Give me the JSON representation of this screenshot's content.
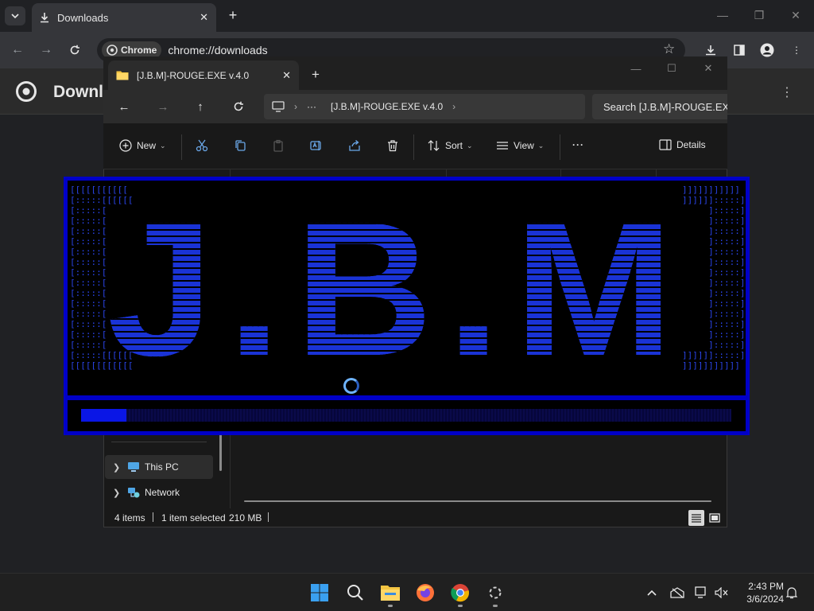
{
  "chrome": {
    "tab_title": "Downloads",
    "chip_label": "Chrome",
    "url": "chrome://downloads",
    "page_title": "Downloads"
  },
  "explorer": {
    "tab_title": "[J.B.M]-ROUGE.EXE v.4.0",
    "breadcrumb_more": "···",
    "breadcrumb_folder": "[J.B.M]-ROUGE.EXE v.4.0",
    "search_placeholder": "Search [J.B.M]-ROUGE.EX",
    "commands": {
      "new": "New",
      "sort": "Sort",
      "view": "View",
      "more": "···",
      "details": "Details"
    },
    "nav": [
      {
        "label": "This PC",
        "icon": "pc-icon"
      },
      {
        "label": "Network",
        "icon": "network-icon"
      }
    ],
    "status": {
      "items": "4 items",
      "selected": "1 item selected",
      "size": "210 MB"
    }
  },
  "splash": {
    "logo_text": "J.B.M",
    "progress": 0.07,
    "accent_color": "#0000c8"
  },
  "taskbar": {
    "time": "2:43 PM",
    "date": "3/6/2024",
    "apps": [
      "windows-start-icon",
      "search-icon",
      "file-explorer-icon",
      "firefox-icon",
      "chrome-icon",
      "loading-icon"
    ]
  }
}
